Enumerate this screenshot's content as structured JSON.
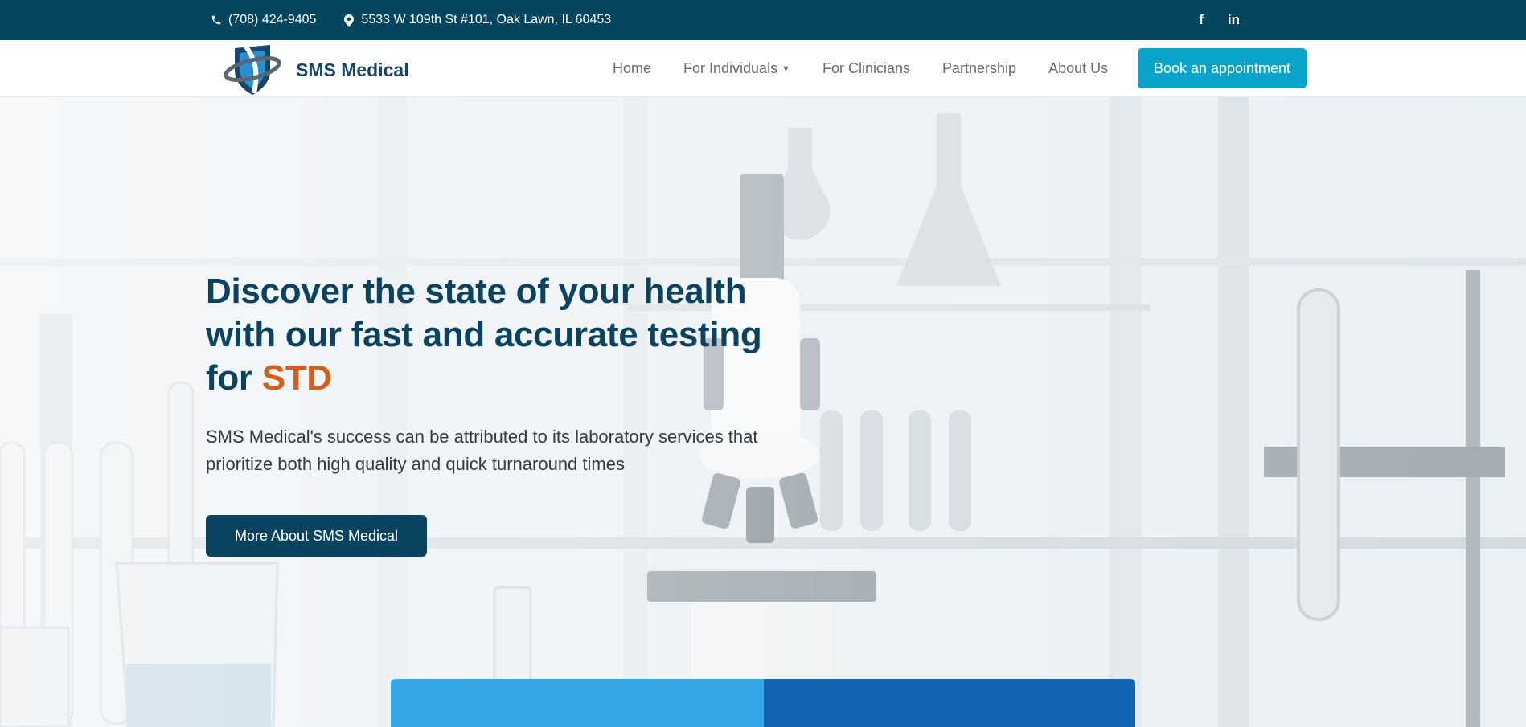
{
  "topbar": {
    "phone": "(708) 424-9405",
    "address": "5533 W 109th St #101, Oak Lawn, IL 60453",
    "phone_icon": "phone-icon",
    "location_icon": "map-pin-icon",
    "social": [
      {
        "name": "facebook-icon",
        "glyph": "f"
      },
      {
        "name": "linkedin-icon",
        "glyph": "in"
      }
    ],
    "background": "#044660"
  },
  "nav": {
    "brand": "SMS Medical",
    "items": [
      {
        "label": "Home"
      },
      {
        "label": "For Individuals",
        "has_dropdown": true
      },
      {
        "label": "For Clinicians"
      },
      {
        "label": "Partnership"
      },
      {
        "label": "About Us"
      }
    ],
    "book_label": "Book an appointment",
    "book_color": "#0aa3c9"
  },
  "hero": {
    "headline_main": "Discover the state of your health with our fast and accurate testing for ",
    "headline_accent": "STD",
    "subtext": "SMS Medical's success can be attributed to its laboratory services that prioritize both high quality and quick turnaround times",
    "cta_label": "More About SMS Medical",
    "headline_color": "#0a4360",
    "accent_color": "#d45f1a"
  },
  "cards": {
    "colors": [
      "#35a7e8",
      "#1264b2"
    ]
  }
}
